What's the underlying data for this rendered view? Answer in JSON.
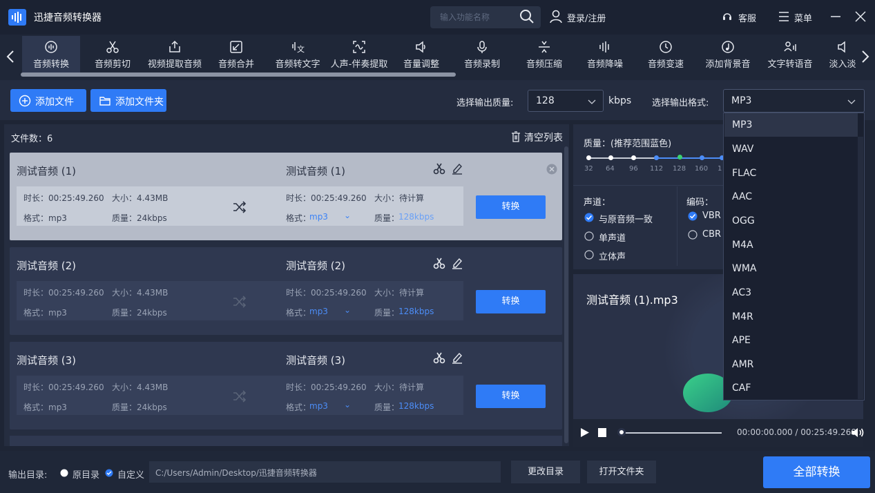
{
  "app": {
    "title": "迅捷音频转换器"
  },
  "header": {
    "search_placeholder": "输入功能名称",
    "login": "登录/注册",
    "service": "客服",
    "menu": "菜单"
  },
  "toolbar": {
    "tools": [
      {
        "label": "音频转换",
        "icon": "audio-convert-icon",
        "active": true
      },
      {
        "label": "音频剪切",
        "icon": "scissors-icon"
      },
      {
        "label": "视频提取音频",
        "icon": "upload-box-icon"
      },
      {
        "label": "音频合并",
        "icon": "merge-icon"
      },
      {
        "label": "音频转文字",
        "icon": "audio-text-icon"
      },
      {
        "label": "人声-伴奏提取",
        "icon": "vocal-extract-icon"
      },
      {
        "label": "音量调整",
        "icon": "volume-icon"
      },
      {
        "label": "音频录制",
        "icon": "microphone-icon"
      },
      {
        "label": "音频压缩",
        "icon": "compress-icon"
      },
      {
        "label": "音频降噪",
        "icon": "denoise-icon"
      },
      {
        "label": "音频变速",
        "icon": "speed-icon"
      },
      {
        "label": "添加背景音",
        "icon": "music-note-icon"
      },
      {
        "label": "文字转语音",
        "icon": "text-speech-icon"
      },
      {
        "label": "淡入淡",
        "icon": "fade-icon"
      }
    ]
  },
  "actions": {
    "add_file": "添加文件",
    "add_folder": "添加文件夹",
    "quality_label": "选择输出质量:",
    "quality_value": "128",
    "kbps": "kbps",
    "format_label": "选择输出格式:",
    "format_value": "MP3"
  },
  "file_list": {
    "count_label": "文件数：6",
    "clear": "清空列表",
    "files": [
      {
        "name_in": "测试音频 (1)",
        "name_out": "测试音频 (1)",
        "duration": "时长：00:25:49.260",
        "size": "大小：4.43MB",
        "format": "格式：mp3",
        "quality": "质量：24kbps",
        "out_duration": "时长：00:25:49.260",
        "out_size": "大小：待计算",
        "out_format_label": "格式：",
        "out_format": "mp3",
        "out_quality_label": "质量：",
        "out_quality": "128kbps",
        "convert": "转换",
        "selected": true
      },
      {
        "name_in": "测试音频 (2)",
        "name_out": "测试音频 (2)",
        "duration": "时长：00:25:49.260",
        "size": "大小：4.43MB",
        "format": "格式：mp3",
        "quality": "质量：24kbps",
        "out_duration": "时长：00:25:49.260",
        "out_size": "大小：待计算",
        "out_format_label": "格式：",
        "out_format": "mp3",
        "out_quality_label": "质量：",
        "out_quality": "128kbps",
        "convert": "转换"
      },
      {
        "name_in": "测试音频 (3)",
        "name_out": "测试音频 (3)",
        "duration": "时长：00:25:49.260",
        "size": "大小：4.43MB",
        "format": "格式：mp3",
        "quality": "质量：24kbps",
        "out_duration": "时长：00:25:49.260",
        "out_size": "大小：待计算",
        "out_format_label": "格式：",
        "out_format": "mp3",
        "out_quality_label": "质量：",
        "out_quality": "128kbps",
        "convert": "转换"
      }
    ]
  },
  "settings": {
    "quality_title": "质量：(推荐范围蓝色)",
    "ticks": [
      "32",
      "64",
      "96",
      "112",
      "128",
      "160",
      "1"
    ],
    "channel_title": "声道：",
    "channels": [
      {
        "label": "与原音频一致",
        "checked": true
      },
      {
        "label": "单声道",
        "checked": false
      },
      {
        "label": "立体声",
        "checked": false
      }
    ],
    "encode_title": "编码：",
    "encodes": [
      {
        "label": "VBR",
        "checked": true
      },
      {
        "label": "CBR",
        "checked": false
      }
    ]
  },
  "player": {
    "title": "测试音频 (1).mp3",
    "time": "00:00:00.000 / 00:25:49.260"
  },
  "format_dropdown": {
    "options": [
      "MP3",
      "WAV",
      "FLAC",
      "AAC",
      "OGG",
      "M4A",
      "WMA",
      "AC3",
      "M4R",
      "APE",
      "AMR",
      "CAF"
    ],
    "selected": "MP3"
  },
  "footer": {
    "output_label": "输出目录:",
    "original_dir": "原目录",
    "custom_dir": "自定义",
    "path": "C:/Users/Admin/Desktop/迅捷音频转换器",
    "change_dir": "更改目录",
    "open_folder": "打开文件夹",
    "convert_all": "全部转换"
  },
  "colors": {
    "accent": "#2f7bf6",
    "background": "#1e2535",
    "selected_card": "#b5bbc8",
    "recommended": "#4c8df7"
  }
}
